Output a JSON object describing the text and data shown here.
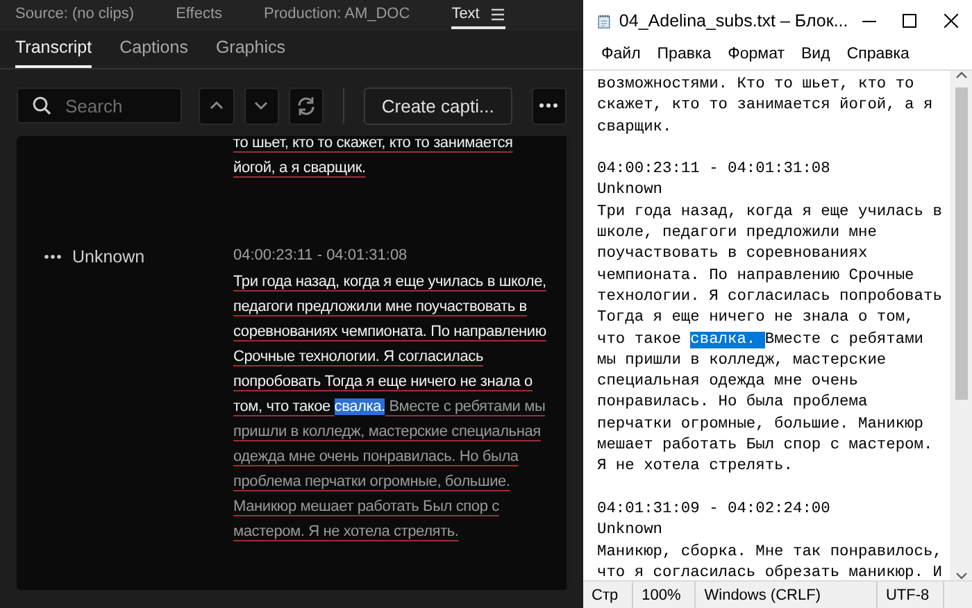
{
  "panel_tabs": [
    {
      "label": "Source: (no clips)",
      "selected": false
    },
    {
      "label": "Effects",
      "selected": false
    },
    {
      "label": "Production: AM_DOC",
      "selected": false
    },
    {
      "label": "Text",
      "selected": true
    }
  ],
  "sub_tabs": [
    {
      "label": "Transcript",
      "selected": true
    },
    {
      "label": "Captions",
      "selected": false
    },
    {
      "label": "Graphics",
      "selected": false
    }
  ],
  "search": {
    "placeholder": "Search"
  },
  "create_button": "Create capti...",
  "transcript": {
    "segments": [
      {
        "played_text": "то шьет, кто то скажет, кто то занимается йогой, а я сварщик."
      },
      {
        "speaker": "Unknown",
        "timecode": "04:00:23:11 - 04:01:31:08",
        "played_text": "Три года назад, когда я еще училась в школе, педагоги предложили мне поучаствовать в соревнованиях чемпионата. По направлению Срочные технологии. Я согласилась попробовать Тогда я еще ничего не знала о том, что такое ",
        "highlight": "свалка.",
        "unplayed_text": " Вместе с ребятами мы пришли в колледж, мастерские специальная одежда мне очень понравилась. Но была проблема перчатки огромные, большие. Маникюр мешает работать Был спор с мастером. Я не хотела стрелять."
      }
    ]
  },
  "notepad": {
    "title": "04_Adelina_subs.txt – Блок...",
    "menu": [
      "Файл",
      "Правка",
      "Формат",
      "Вид",
      "Справка"
    ],
    "lines": [
      {
        "kind": "plain",
        "text": "возможностями. Кто то шьет, кто то"
      },
      {
        "kind": "plain",
        "text": "скажет, кто то занимается йогой, а я"
      },
      {
        "kind": "plain",
        "text": "сварщик."
      },
      {
        "kind": "blank"
      },
      {
        "kind": "plain",
        "text": "04:00:23:11 - 04:01:31:08"
      },
      {
        "kind": "plain",
        "text": "Unknown"
      },
      {
        "kind": "plain",
        "text": "Три года назад, когда я еще училась в"
      },
      {
        "kind": "plain",
        "text": "школе, педагоги предложили мне"
      },
      {
        "kind": "plain",
        "text": "поучаствовать в соревнованиях"
      },
      {
        "kind": "plain",
        "text": "чемпионата. По направлению Срочные"
      },
      {
        "kind": "plain",
        "text": "технологии. Я согласилась попробовать"
      },
      {
        "kind": "plain",
        "text": "Тогда я еще ничего не знала о том,"
      },
      {
        "kind": "selection",
        "before": "что такое ",
        "selected": "свалка. ",
        "after": "Вместе с ребятами"
      },
      {
        "kind": "plain",
        "text": "мы пришли в колледж, мастерские"
      },
      {
        "kind": "plain",
        "text": "специальная одежда мне очень"
      },
      {
        "kind": "plain",
        "text": "понравилась. Но была проблема"
      },
      {
        "kind": "plain",
        "text": "перчатки огромные, большие. Маникюр"
      },
      {
        "kind": "plain",
        "text": "мешает работать Был спор с мастером."
      },
      {
        "kind": "plain",
        "text": "Я не хотела стрелять."
      },
      {
        "kind": "blank"
      },
      {
        "kind": "plain",
        "text": "04:01:31:09 - 04:02:24:00"
      },
      {
        "kind": "plain",
        "text": "Unknown"
      },
      {
        "kind": "plain",
        "text": "Маникюр, сборка. Мне так понравилось,"
      },
      {
        "kind": "plain",
        "text": "что я согласилась обрезать маникюр. И"
      }
    ],
    "status": [
      "Стр",
      "100%",
      "Windows (CRLF)",
      "UTF-8"
    ]
  }
}
